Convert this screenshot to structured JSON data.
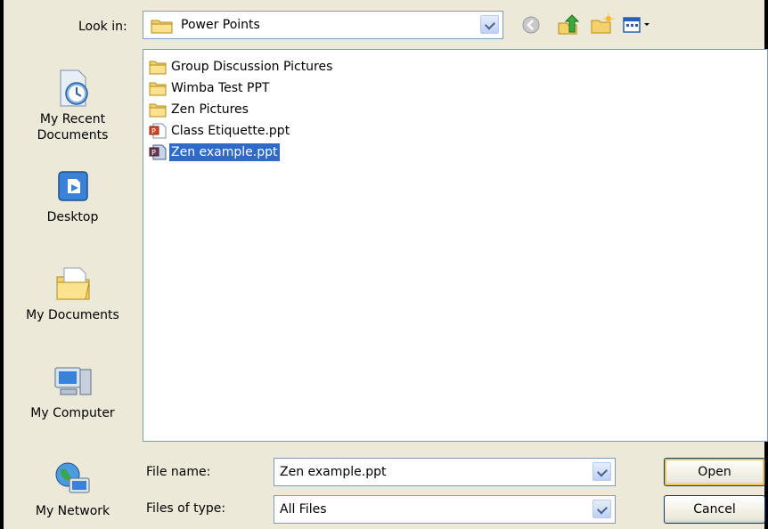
{
  "look_in": {
    "label": "Look in:",
    "value": "Power Points"
  },
  "toolbar": {
    "icons": [
      "back-icon",
      "up-one-level-icon",
      "new-folder-icon",
      "views-menu-icon"
    ]
  },
  "places_bar": {
    "items": [
      {
        "label": "My Recent\nDocuments",
        "icon": "recent-documents-icon"
      },
      {
        "label": "Desktop",
        "icon": "desktop-icon"
      },
      {
        "label": "My Documents",
        "icon": "my-documents-icon"
      },
      {
        "label": "My Computer",
        "icon": "my-computer-icon"
      },
      {
        "label": "My Network",
        "icon": "my-network-icon"
      }
    ]
  },
  "files": [
    {
      "name": "Group Discussion Pictures",
      "type": "folder"
    },
    {
      "name": "Wimba Test PPT",
      "type": "folder"
    },
    {
      "name": "Zen Pictures",
      "type": "folder"
    },
    {
      "name": "Class Etiquette.ppt",
      "type": "ppt"
    },
    {
      "name": "Zen example.ppt",
      "type": "ppt",
      "selected": true
    }
  ],
  "file_name": {
    "label": "File name:",
    "value": "Zen example.ppt"
  },
  "file_type": {
    "label": "Files of type:",
    "value": "All Files"
  },
  "buttons": {
    "open": "Open",
    "cancel": "Cancel"
  },
  "colors": {
    "dialog_bg": "#ece9d8",
    "selection": "#316ac5",
    "folder": "#f5d16b",
    "field_border": "#7f9db9"
  }
}
